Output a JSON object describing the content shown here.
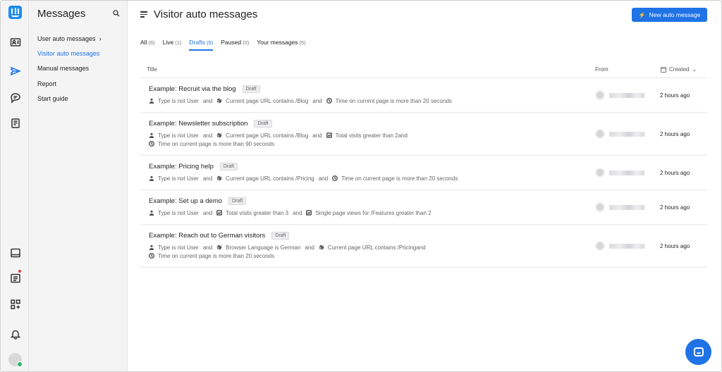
{
  "sidebar": {
    "title": "Messages",
    "items": [
      {
        "label": "User auto messages",
        "has_chevron": true
      },
      {
        "label": "Visitor auto messages",
        "active": true
      },
      {
        "label": "Manual messages"
      },
      {
        "label": "Report"
      },
      {
        "label": "Start guide"
      }
    ]
  },
  "header": {
    "title": "Visitor auto messages",
    "new_button_label": "New auto message"
  },
  "tabs": [
    {
      "label": "All",
      "count": "(6)"
    },
    {
      "label": "Live",
      "count": "(1)"
    },
    {
      "label": "Drafts",
      "count": "(5)",
      "active": true
    },
    {
      "label": "Paused",
      "count": "(0)"
    },
    {
      "label": "Your messages",
      "count": "(5)"
    }
  ],
  "table": {
    "columns": {
      "title": "Title",
      "from": "From",
      "created": "Created"
    },
    "rows": [
      {
        "title": "Example: Recruit via the blog",
        "badge": "Draft",
        "conditions": [
          {
            "icon": "user-icon",
            "text": "Type is not User"
          },
          {
            "icon": "globe-icon",
            "text": "Current page URL contains /Blog"
          },
          {
            "icon": "clock-icon",
            "text": "Time on current page is more than 20 seconds"
          }
        ],
        "created": "2 hours ago"
      },
      {
        "title": "Example: Newsletter subscription",
        "badge": "Draft",
        "conditions": [
          {
            "icon": "user-icon",
            "text": "Type is not User"
          },
          {
            "icon": "globe-icon",
            "text": "Current page URL contains /Blog"
          },
          {
            "icon": "chart-icon",
            "text": "Total visits greater than 2"
          },
          {
            "icon": "clock-icon",
            "text": "Time on current page is more than 90 seconds"
          }
        ],
        "created": "2 hours ago"
      },
      {
        "title": "Example: Pricing help",
        "badge": "Draft",
        "conditions": [
          {
            "icon": "user-icon",
            "text": "Type is not User"
          },
          {
            "icon": "globe-icon",
            "text": "Current page URL contains /Pricing"
          },
          {
            "icon": "clock-icon",
            "text": "Time on current page is more than 20 seconds"
          }
        ],
        "created": "2 hours ago"
      },
      {
        "title": "Example: Set up a demo",
        "badge": "Draft",
        "conditions": [
          {
            "icon": "user-icon",
            "text": "Type is not User"
          },
          {
            "icon": "chart-icon",
            "text": "Total visits greater than 3"
          },
          {
            "icon": "chart-icon",
            "text": "Single page views for /Features greater than 2"
          }
        ],
        "created": "2 hours ago"
      },
      {
        "title": "Example: Reach out to German visitors",
        "badge": "Draft",
        "conditions": [
          {
            "icon": "user-icon",
            "text": "Type is not User"
          },
          {
            "icon": "globe-icon",
            "text": "Browser Language is German"
          },
          {
            "icon": "globe-icon",
            "text": "Current page URL contains /Pricing"
          },
          {
            "icon": "clock-icon",
            "text": "Time on current page is more than 20 seconds"
          }
        ],
        "created": "2 hours ago"
      }
    ],
    "and_label": "and"
  },
  "colors": {
    "accent": "#1f73e6",
    "sidebar_bg": "#f4f4f5"
  }
}
